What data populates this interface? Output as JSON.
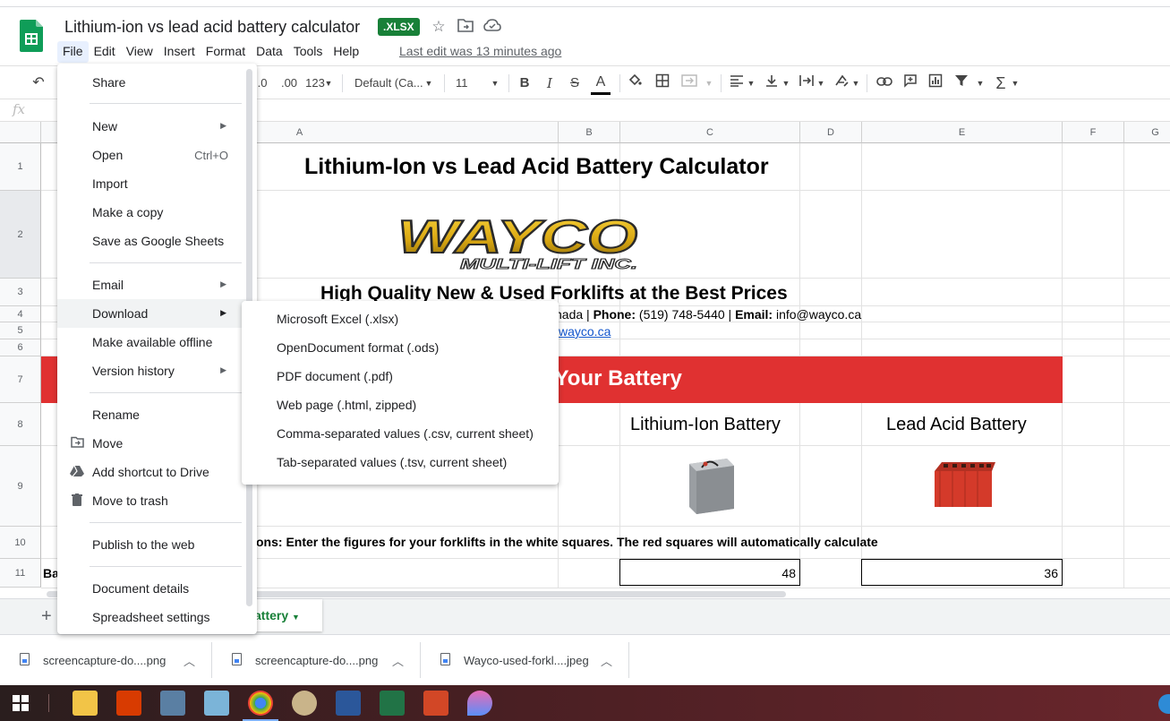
{
  "doc": {
    "title": "Lithium-ion vs lead acid battery calculator",
    "badge": ".XLSX",
    "last_edit": "Last edit was 13 minutes ago"
  },
  "menubar": [
    "File",
    "Edit",
    "View",
    "Insert",
    "Format",
    "Data",
    "Tools",
    "Help"
  ],
  "toolbar": {
    "dec_decrease": ".0",
    "dec_increase": ".00",
    "number_format": "123",
    "font": "Default (Ca...",
    "font_size": "11",
    "bold": "B",
    "italic": "I",
    "strike": "S",
    "text_color": "A"
  },
  "formula_bar": {
    "fx": "fx"
  },
  "columns": [
    "A",
    "B",
    "C",
    "D",
    "E",
    "F",
    "G"
  ],
  "rows": [
    "1",
    "2",
    "3",
    "4",
    "5",
    "6",
    "7",
    "8",
    "9",
    "10",
    "11"
  ],
  "sheet": {
    "title": "Lithium-Ion vs Lead Acid Battery Calculator",
    "logo_main": "WAYCO",
    "logo_sub": "MULTI-LIFT INC.",
    "tagline": "High Quality New & Used Forklifts at the Best Prices",
    "contact_prefix": "nada | ",
    "phone_label": "Phone:",
    "phone": " (519) 748-5440  |  ",
    "email_label": "Email:",
    "email": " info@wayco.ca",
    "website": "wayco.ca",
    "banner": "e Your Battery",
    "lithium_header": "Lithium-Ion Battery",
    "lead_header": "Lead Acid Battery",
    "instructions": "ons: Enter the figures for your forklifts in the white squares. The red squares will automatically calculate",
    "row11_label": "Ba",
    "lithium_voltage": "48",
    "lead_voltage": "36"
  },
  "sheet_tab": {
    "label": "attery"
  },
  "file_menu": {
    "share": "Share",
    "new": "New",
    "open": "Open",
    "open_shortcut": "Ctrl+O",
    "import": "Import",
    "make_copy": "Make a copy",
    "save_as_sheets": "Save as Google Sheets",
    "email": "Email",
    "download": "Download",
    "offline": "Make available offline",
    "version_history": "Version history",
    "rename": "Rename",
    "move": "Move",
    "add_shortcut": "Add shortcut to Drive",
    "trash": "Move to trash",
    "publish": "Publish to the web",
    "details": "Document details",
    "settings": "Spreadsheet settings"
  },
  "download_menu": [
    "Microsoft Excel (.xlsx)",
    "OpenDocument format (.ods)",
    "PDF document (.pdf)",
    "Web page (.html, zipped)",
    "Comma-separated values (.csv, current sheet)",
    "Tab-separated values (.tsv, current sheet)"
  ],
  "downloads": [
    "screencapture-do....png",
    "screencapture-do....png",
    "Wayco-used-forkl....jpeg"
  ],
  "colors": {
    "sheets_green": "#188038",
    "banner_red": "#e03131",
    "link_blue": "#1155cc"
  }
}
